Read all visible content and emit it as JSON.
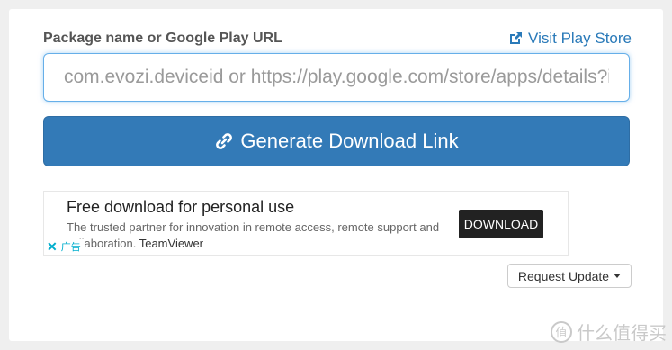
{
  "form": {
    "label": "Package name or Google Play URL",
    "visit_store_label": "Visit Play Store",
    "input_placeholder": "com.evozi.deviceid or https://play.google.com/store/apps/details?id=com.evozi.deviceid",
    "generate_label": "Generate Download Link",
    "request_update_label": "Request Update"
  },
  "ad": {
    "title": "Free download for personal use",
    "description": "The trusted partner for innovation in remote access, remote support and collaboration.",
    "brand": "TeamViewer",
    "button_label": "DOWNLOAD",
    "ad_marker": "广告"
  },
  "watermark": {
    "text": "什么值得买"
  },
  "colors": {
    "accent": "#337ab7",
    "link": "#2a7ab9",
    "ad_choice": "#00aecd"
  },
  "icons": {
    "store_link": "external-link-icon",
    "generate": "link-icon",
    "ad_close": "close-icon",
    "dropdown": "caret-down-icon",
    "watermark": "watermark-logo-icon"
  }
}
